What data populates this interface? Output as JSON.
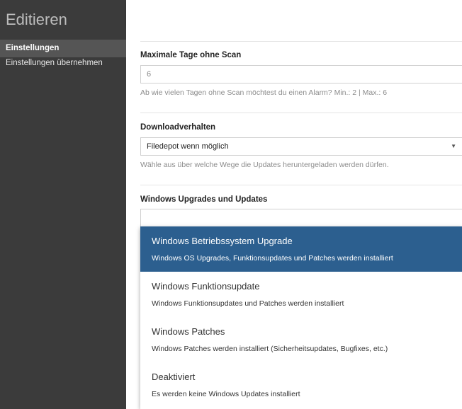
{
  "sidebar": {
    "title": "Editieren",
    "items": [
      {
        "label": "Einstellungen",
        "active": true
      },
      {
        "label": "Einstellungen übernehmen",
        "active": false
      }
    ]
  },
  "form": {
    "max_days": {
      "label": "Maximale Tage ohne Scan",
      "value": "6",
      "help": "Ab wie vielen Tagen ohne Scan möchtest du einen Alarm? Min.: 2 | Max.: 6"
    },
    "download": {
      "label": "Downloadverhalten",
      "value": "Filedepot wenn möglich",
      "help": "Wähle aus über welche Wege die Updates heruntergeladen werden dürfen."
    },
    "windows_updates": {
      "label": "Windows Upgrades und Updates",
      "value": "",
      "options": [
        {
          "title": "Windows Betriebssystem Upgrade",
          "desc": "Windows OS Upgrades, Funktionsupdates und Patches werden installiert",
          "selected": true
        },
        {
          "title": "Windows Funktionsupdate",
          "desc": "Windows Funktionsupdates und Patches werden installiert",
          "selected": false
        },
        {
          "title": "Windows Patches",
          "desc": "Windows Patches werden installiert (Sicherheitsupdates, Bugfixes, etc.)",
          "selected": false
        },
        {
          "title": "Deaktiviert",
          "desc": "Es werden keine Windows Updates installiert",
          "selected": false
        }
      ]
    }
  },
  "colors": {
    "sidebar_bg": "#3b3b3b",
    "selected_option_bg": "#2c5f8f"
  },
  "icons": {
    "dropdown_caret": "caret-down-icon"
  }
}
